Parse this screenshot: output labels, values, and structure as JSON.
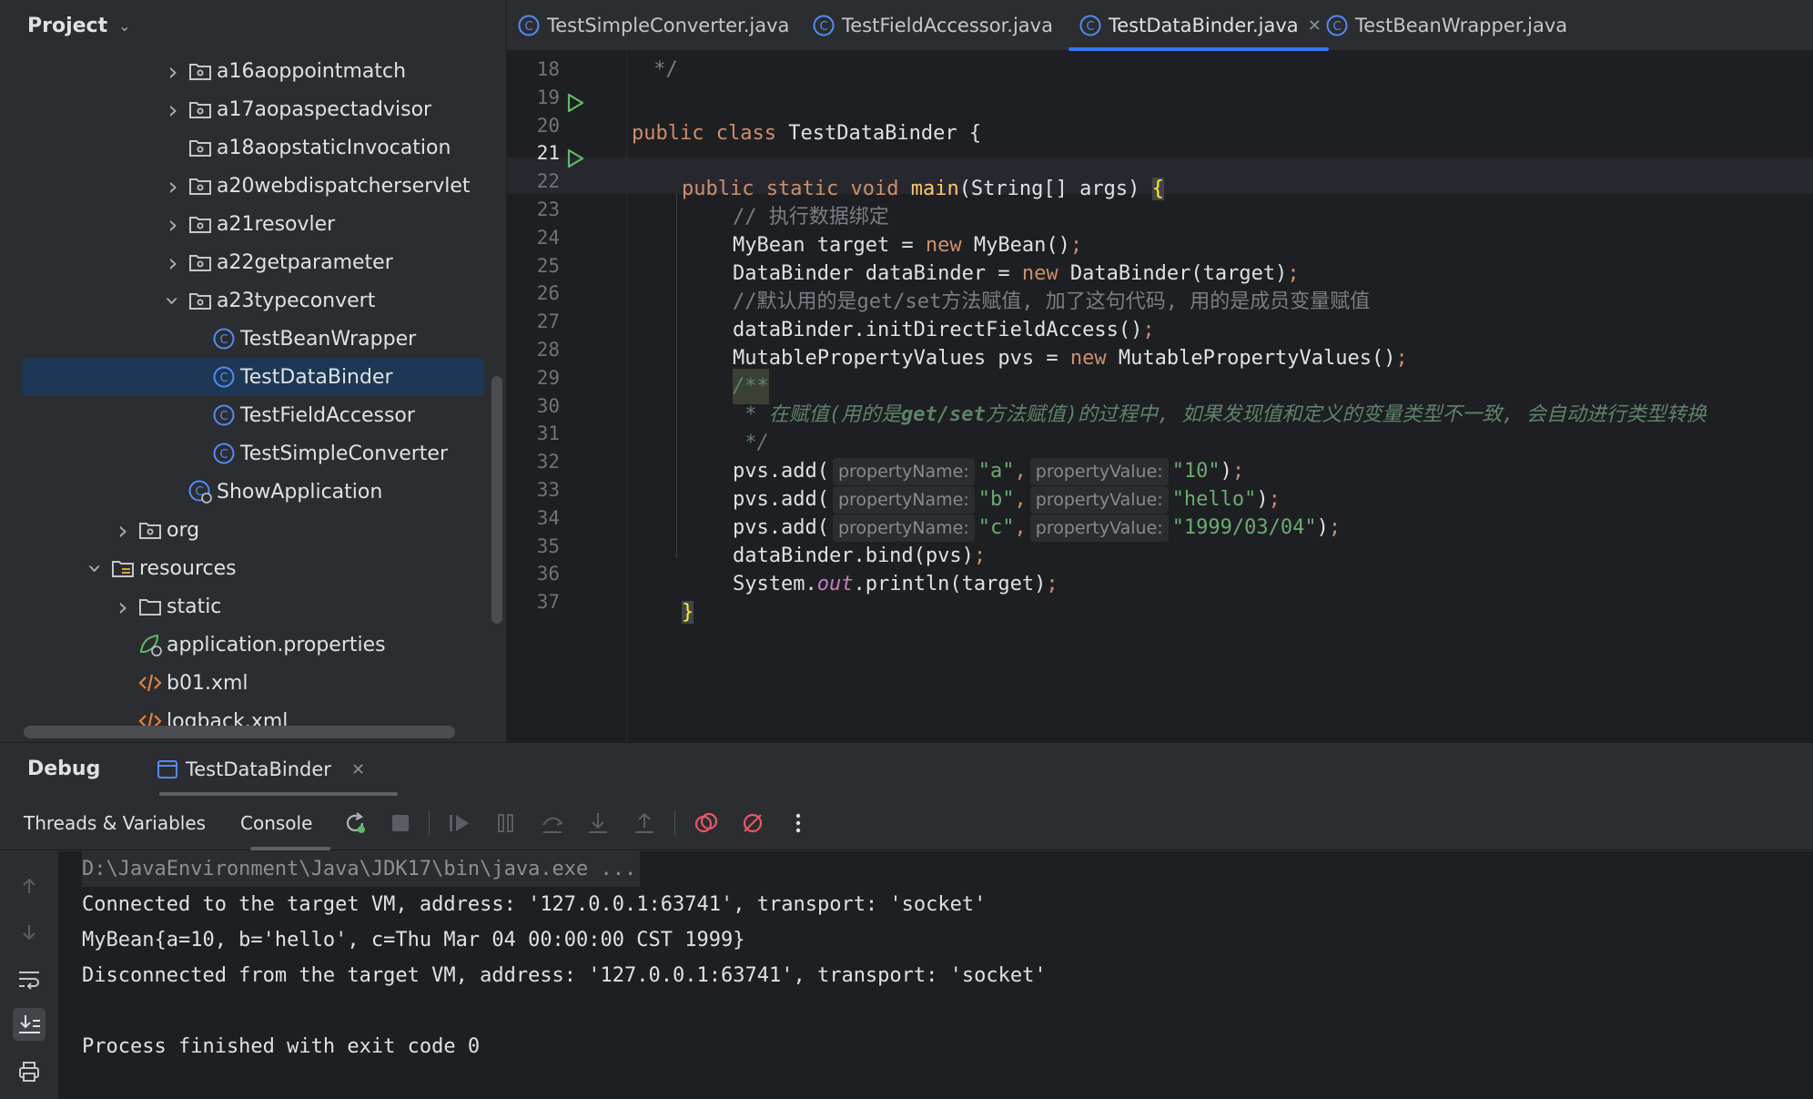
{
  "project": {
    "title": "Project",
    "tree": [
      {
        "label": "a16aoppointmatch",
        "type": "package",
        "expand": "collapsed"
      },
      {
        "label": "a17aopaspectadvisor",
        "type": "package",
        "expand": "collapsed"
      },
      {
        "label": "a18aopstaticInvocation",
        "type": "package",
        "expand": "none"
      },
      {
        "label": "a20webdispatcherservlet",
        "type": "package",
        "expand": "collapsed"
      },
      {
        "label": "a21resovler",
        "type": "package",
        "expand": "collapsed"
      },
      {
        "label": "a22getparameter",
        "type": "package",
        "expand": "collapsed"
      },
      {
        "label": "a23typeconvert",
        "type": "package",
        "expand": "expanded"
      },
      {
        "label": "TestBeanWrapper",
        "type": "class",
        "expand": "none"
      },
      {
        "label": "TestDataBinder",
        "type": "class",
        "expand": "none",
        "selected": true
      },
      {
        "label": "TestFieldAccessor",
        "type": "class",
        "expand": "none"
      },
      {
        "label": "TestSimpleConverter",
        "type": "class",
        "expand": "none"
      },
      {
        "label": "ShowApplication",
        "type": "spring-class",
        "expand": "none"
      },
      {
        "label": "org",
        "type": "package",
        "expand": "collapsed"
      },
      {
        "label": "resources",
        "type": "resources-folder",
        "expand": "expanded"
      },
      {
        "label": "static",
        "type": "folder",
        "expand": "collapsed"
      },
      {
        "label": "application.properties",
        "type": "properties-file",
        "expand": "none"
      },
      {
        "label": "b01.xml",
        "type": "xml-file",
        "expand": "none"
      },
      {
        "label": "logback.xml",
        "type": "xml-file",
        "expand": "none"
      }
    ]
  },
  "editor_tabs": [
    {
      "label": "TestSimpleConverter.java",
      "active": false
    },
    {
      "label": "TestFieldAccessor.java",
      "active": false
    },
    {
      "label": "TestDataBinder.java",
      "active": true
    },
    {
      "label": "TestBeanWrapper.java",
      "active": false
    }
  ],
  "code": {
    "current_line": "21",
    "lines": [
      {
        "n": "18"
      },
      {
        "n": "19"
      },
      {
        "n": "20"
      },
      {
        "n": "21"
      },
      {
        "n": "22"
      },
      {
        "n": "23"
      },
      {
        "n": "24"
      },
      {
        "n": "25"
      },
      {
        "n": "26"
      },
      {
        "n": "27"
      },
      {
        "n": "28"
      },
      {
        "n": "29"
      },
      {
        "n": "30"
      },
      {
        "n": "31"
      },
      {
        "n": "32"
      },
      {
        "n": "33"
      },
      {
        "n": "34"
      },
      {
        "n": "35"
      },
      {
        "n": "36"
      },
      {
        "n": "37"
      }
    ],
    "text": {
      "l18": " */",
      "public": "public",
      "class": "class",
      "class_name": "TestDataBinder",
      "brace_open": "{",
      "static": "static",
      "void": "void",
      "main": "main",
      "main_params": "(String[] args)",
      "c22": "// 执行数据绑定",
      "t23a": "MyBean target = ",
      "new": "new",
      "t23b": "MyBean()",
      "t24a": "DataBinder dataBinder = ",
      "t24b": "DataBinder(target)",
      "c25": "//默认用的是get/set方法赋值, 加了这句代码, 用的是成员变量赋值",
      "t26": "dataBinder.initDirectFieldAccess()",
      "t27a": "MutablePropertyValues pvs = ",
      "t27b": "MutablePropertyValues()",
      "doc28": "/**",
      "doc29a": " * 在赋值(用的是",
      "doc29b": "get/set",
      "doc29c": "方法赋值)的过程中, 如果发现值和定义的变量类型不一致, 会自动进行类型转换",
      "doc30": " */",
      "pvs_add": "pvs.add(",
      "hint_name": "propertyName:",
      "hint_value": "propertyValue:",
      "a": "\"a\"",
      "v10": "\"10\"",
      "b": "\"b\"",
      "vhello": "\"hello\"",
      "c": "\"c\"",
      "vdate": "\"1999/03/04\"",
      "comma": ",",
      "close_paren": ")",
      "semi": ";",
      "t34": "dataBinder.bind(pvs)",
      "t35a": "System.",
      "out": "out",
      "t35b": ".println(target)",
      "brace_close": "}"
    }
  },
  "debug": {
    "title": "Debug",
    "session_tab": "TestDataBinder",
    "tabs": [
      "Threads & Variables",
      "Console"
    ],
    "active_tab": "Console",
    "console_lines": [
      "D:\\JavaEnvironment\\Java\\JDK17\\bin\\java.exe ...",
      "Connected to the target VM, address: '127.0.0.1:63741', transport: 'socket'",
      "MyBean{a=10, b='hello', c=Thu Mar 04 00:00:00 CST 1999}",
      "Disconnected from the target VM, address: '127.0.0.1:63741', transport: 'socket'",
      "",
      "Process finished with exit code 0"
    ]
  },
  "colors": {
    "selection": "#1d3754",
    "accent": "#3574f0",
    "run_icon": "#5fb865",
    "class_icon": "#548af7",
    "stop_icon": "#e55765"
  }
}
